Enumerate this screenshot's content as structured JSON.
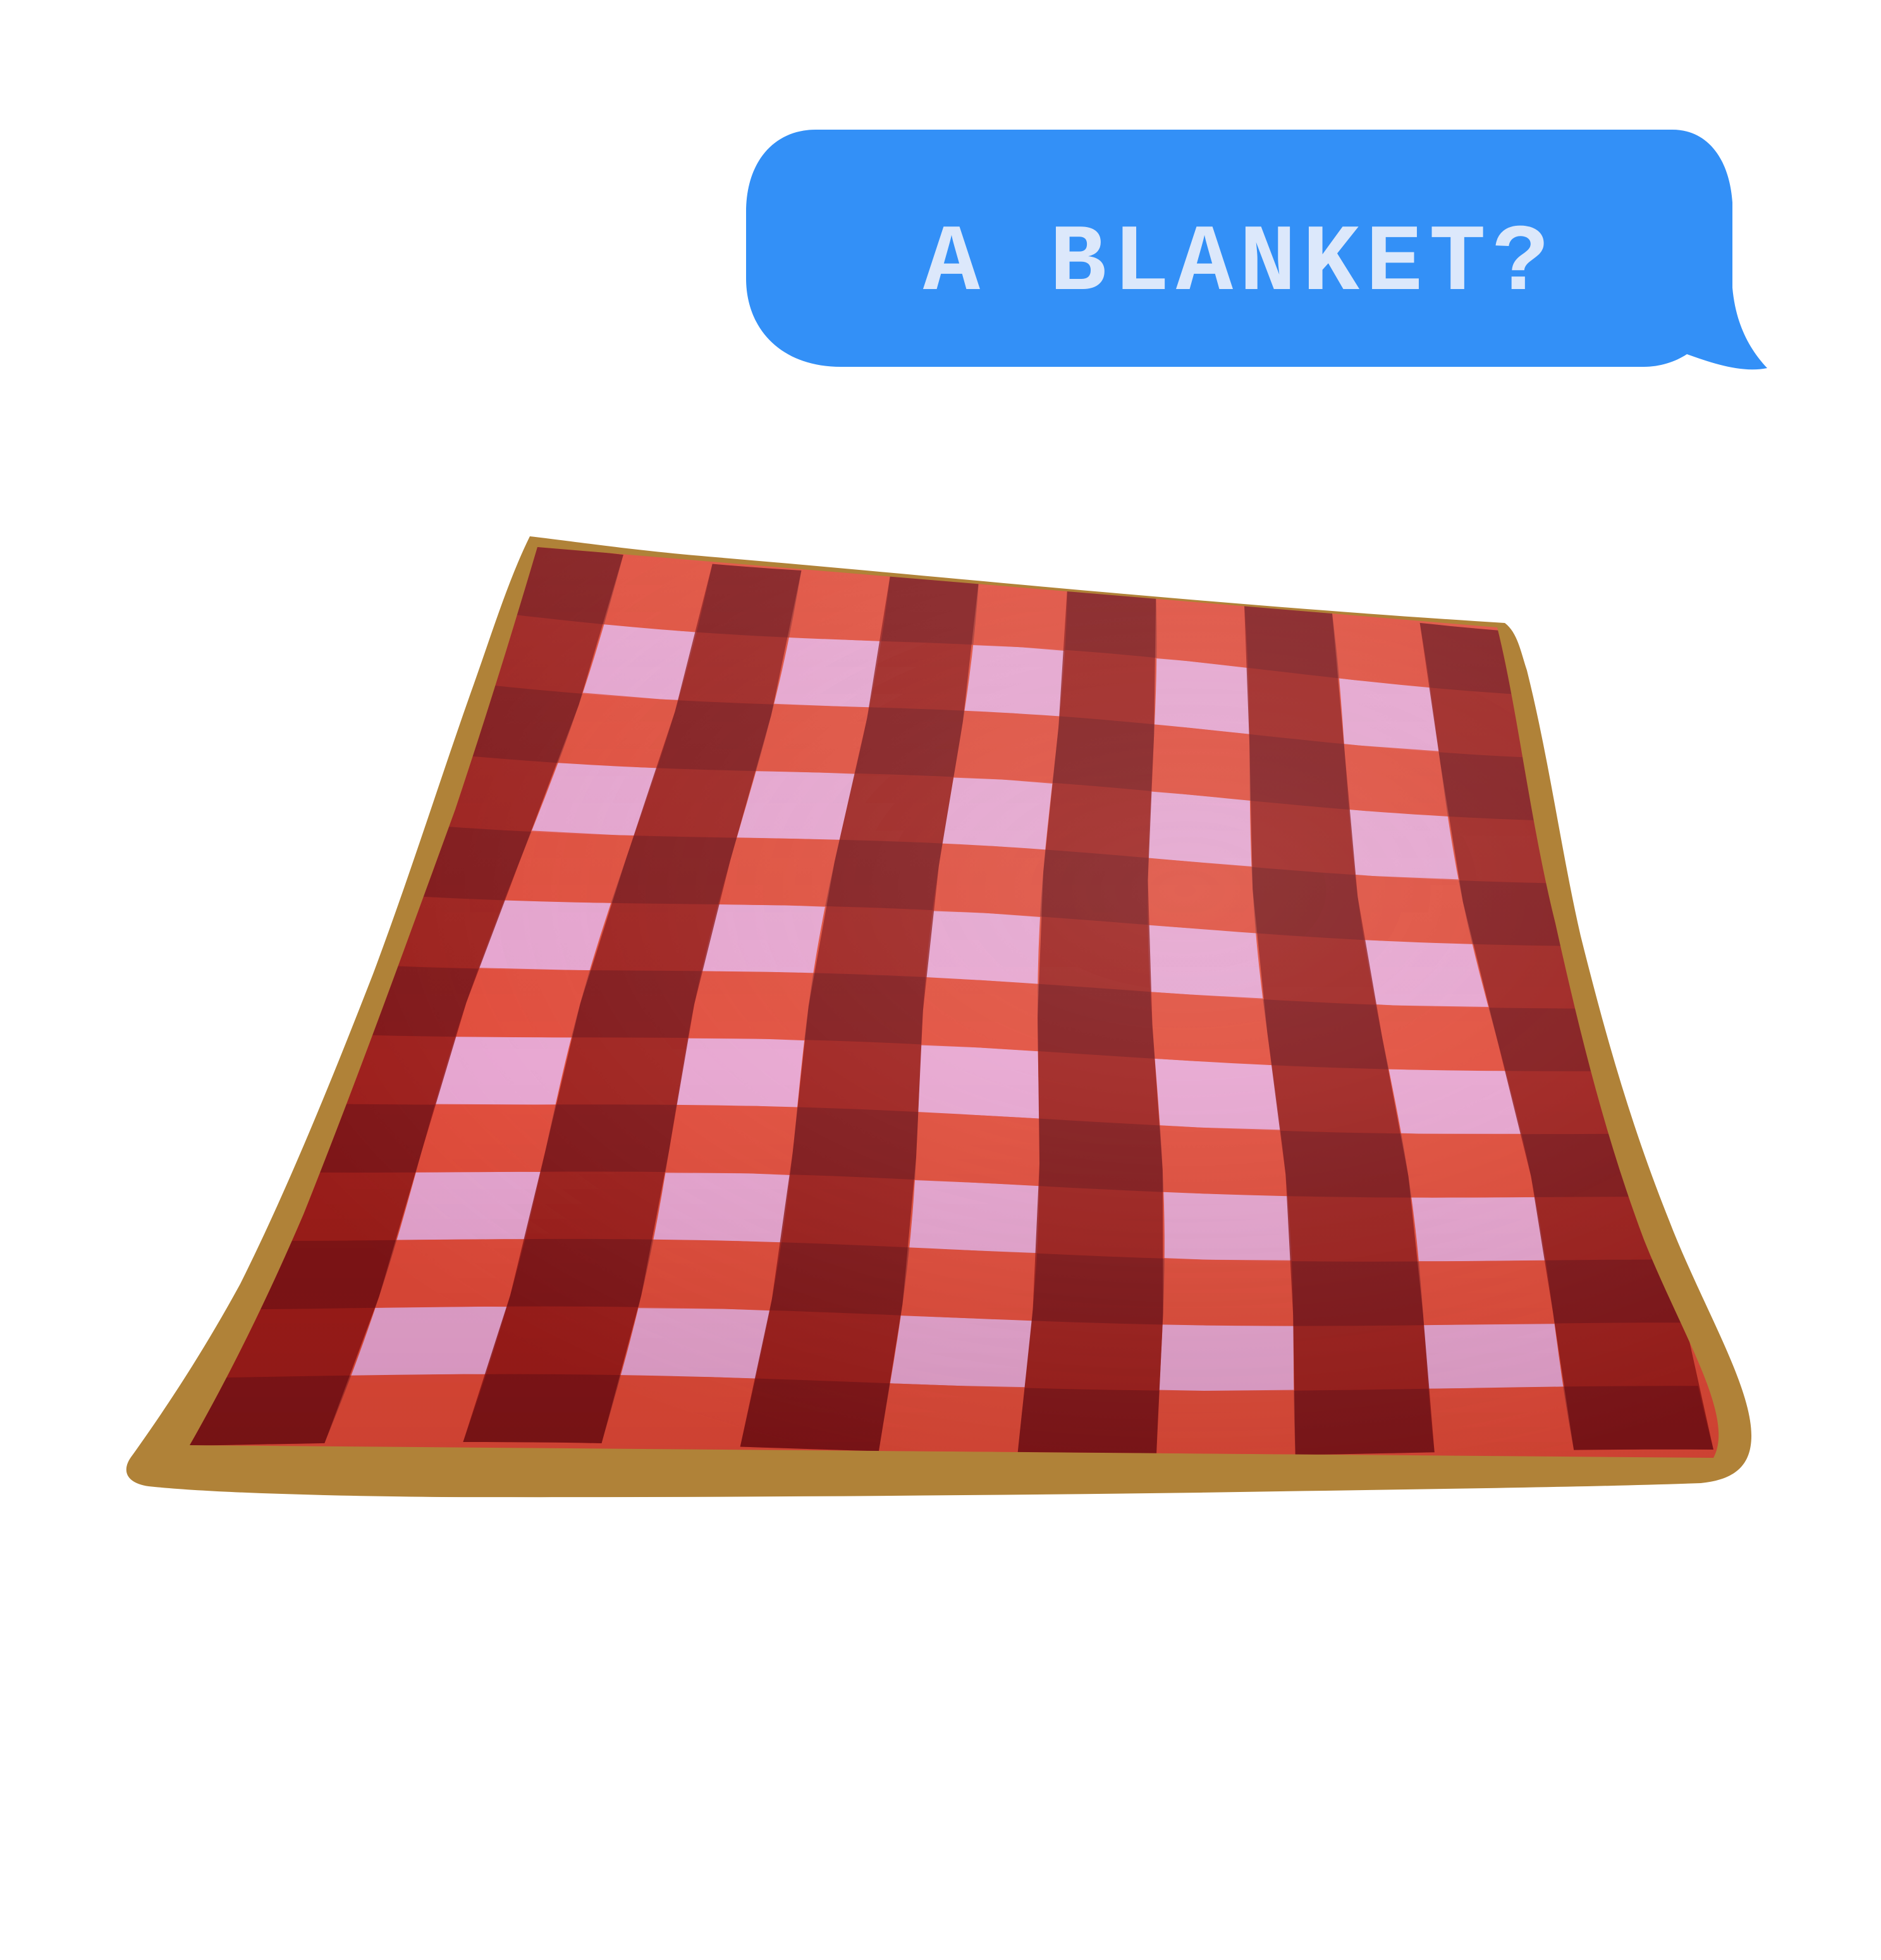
{
  "message_bubble": {
    "text": "A BLANKET?",
    "bubble_color": "#3390f7",
    "text_color": "#dce8fb"
  },
  "illustration": {
    "subject": "picnic-blanket-icon",
    "pattern": "gingham",
    "colors": {
      "border": "#b08238",
      "band_dark": "#8e1414",
      "band_mid": "#e04a38",
      "light_square": "#e7b2e6",
      "shade": "#4a0a14"
    }
  }
}
